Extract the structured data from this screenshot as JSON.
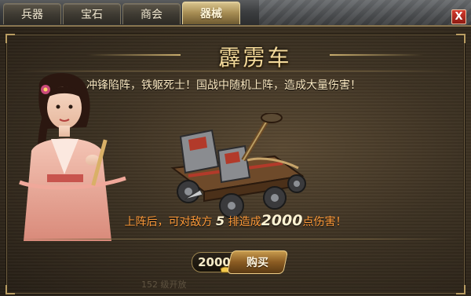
{
  "tabs": [
    {
      "label": "兵器",
      "active": false
    },
    {
      "label": "宝石",
      "active": false
    },
    {
      "label": "商会",
      "active": false
    },
    {
      "label": "器械",
      "active": true
    }
  ],
  "close_label": "X",
  "item": {
    "name": "霹雳车",
    "description": "冲锋陷阵，铁躯死士！国战中随机上阵，造成大量伤害！",
    "effect": {
      "prefix": "上阵后，可对敌方",
      "rows": "5",
      "middle": "排造成",
      "damage": "2000",
      "suffix": "点伤害！"
    },
    "price": "2000",
    "buy_label": "购买",
    "level_note": "152 级开放"
  },
  "icons": {
    "currency": "gold-ingot-icon",
    "close": "close-icon"
  },
  "colors": {
    "accent_gold": "#f3d99a",
    "effect_orange": "#ff9b3a",
    "close_red": "#c22a20"
  }
}
